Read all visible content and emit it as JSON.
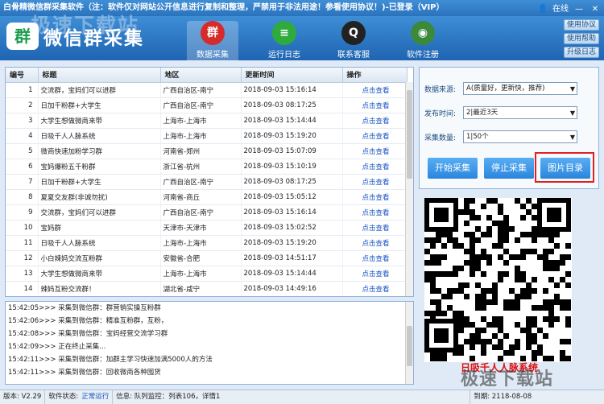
{
  "window": {
    "title": "白骨精微信群采集软件（注：软件仅对网站公开信息进行复制和整理，严禁用于非法用途！参看使用协议！)-已登录（VIP）",
    "online": "在线"
  },
  "watermark": "极速下载站",
  "logo": {
    "badge": "群",
    "name": "微信群采集"
  },
  "nav": [
    {
      "label": "数据采集",
      "icon": "群",
      "color": "#d62b2b"
    },
    {
      "label": "运行日志",
      "icon": "≡",
      "color": "#2faa3c"
    },
    {
      "label": "联系客服",
      "icon": "Q",
      "color": "#222"
    },
    {
      "label": "软件注册",
      "icon": "◉",
      "color": "#3b8a3b"
    }
  ],
  "side_buttons": [
    "使用协议",
    "使用帮助",
    "升级日志"
  ],
  "table": {
    "headers": [
      "编号",
      "标题",
      "地区",
      "更新时间",
      "操作"
    ],
    "rows": [
      [
        "1",
        "交流群，宝妈们可以进群",
        "广西自治区-南宁",
        "2018-09-03 15:16:14",
        "点击查看"
      ],
      [
        "2",
        "日加千粉群+大学生",
        "广西自治区-南宁",
        "2018-09-03 08:17:25",
        "点击查看"
      ],
      [
        "3",
        "大学生想做微商来带",
        "上海市-上海市",
        "2018-09-03 15:14:44",
        "点击查看"
      ],
      [
        "4",
        "日吸千人人脉系统",
        "上海市-上海市",
        "2018-09-03 15:19:20",
        "点击查看"
      ],
      [
        "5",
        "微商快速加粉学习群",
        "河南省-郑州",
        "2018-09-03 15:07:09",
        "点击查看"
      ],
      [
        "6",
        "宝妈爆粉五千粉群",
        "浙江省-杭州",
        "2018-09-03 15:10:19",
        "点击查看"
      ],
      [
        "7",
        "日加千粉群+大学生",
        "广西自治区-南宁",
        "2018-09-03 08:17:25",
        "点击查看"
      ],
      [
        "8",
        "夏夏交友群(非诚勿扰)",
        "河南省-商丘",
        "2018-09-03 15:05:12",
        "点击查看"
      ],
      [
        "9",
        "交流群，宝妈们可以进群",
        "广西自治区-南宁",
        "2018-09-03 15:16:14",
        "点击查看"
      ],
      [
        "10",
        "宝妈群",
        "天津市-天津市",
        "2018-09-03 15:02:52",
        "点击查看"
      ],
      [
        "11",
        "日吸千人人脉系统",
        "上海市-上海市",
        "2018-09-03 15:19:20",
        "点击查看"
      ],
      [
        "12",
        "小白辣妈交流互粉群",
        "安徽省-合肥",
        "2018-09-03 14:51:17",
        "点击查看"
      ],
      [
        "13",
        "大学生想做微商来带",
        "上海市-上海市",
        "2018-09-03 15:14:44",
        "点击查看"
      ],
      [
        "14",
        "辣妈互粉交流群！",
        "湖北省-咸宁",
        "2018-09-03 14:49:16",
        "点击查看"
      ]
    ]
  },
  "log": [
    "15:42:05>>> 采集到微信群：群营销实操互粉群",
    "15:42:06>>> 采集到微信群：精准互粉群，互粉，",
    "15:42:08>>> 采集到微信群：宝妈经营交流学习群",
    "15:42:09>>> 正在终止采集...",
    "15:42:11>>> 采集到微信群：加群主学习快速加满5000人的方法",
    "15:42:11>>> 采集到微信群：回收微商各种囤货"
  ],
  "form": {
    "source_label": "数据来源:",
    "source_value": "A(质量好，更新快，推荐)",
    "time_label": "发布时间:",
    "time_value": "2|最近3天",
    "count_label": "采集数量:",
    "count_value": "1|50个",
    "start": "开始采集",
    "stop": "停止采集",
    "images": "图片目录"
  },
  "qr_caption": "日吸千人人脉系统",
  "status": {
    "version": "版本: V2.29",
    "state_label": "软件状态:",
    "state_value": "正常运行",
    "info": "信息:  队列监控：列表106，详情1",
    "expire": "到期:  2118-08-08"
  },
  "colors": {
    "accent": "#2a85dc",
    "header": "#2b72bd",
    "link": "#1a55c2",
    "red": "#e02020"
  }
}
